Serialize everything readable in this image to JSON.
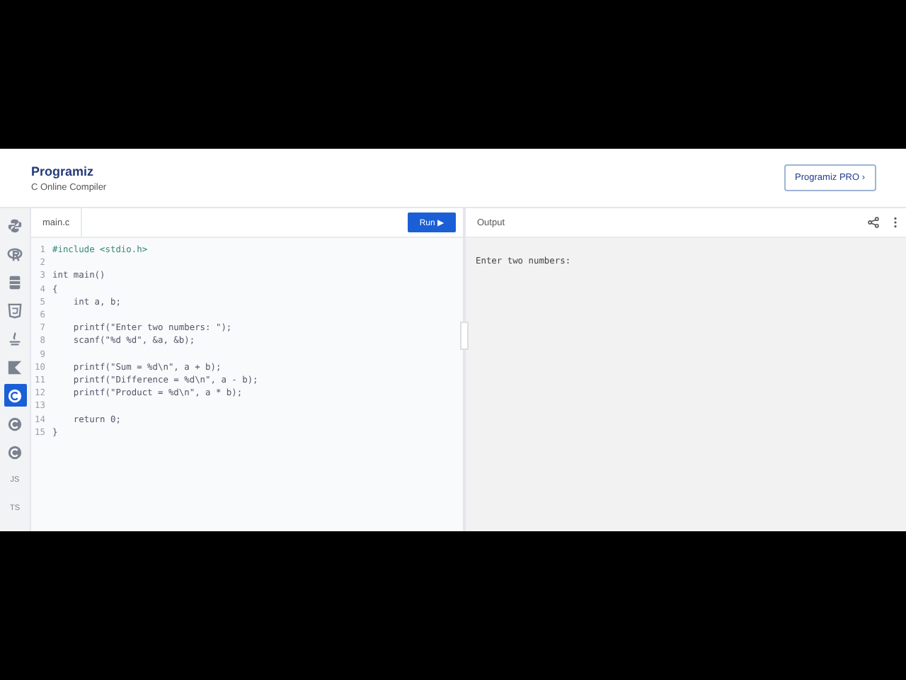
{
  "header": {
    "logo": "Programiz",
    "subtitle": "C Online Compiler",
    "pro_button": "Programiz PRO ›"
  },
  "sidebar": {
    "items": [
      {
        "kind": "python",
        "selected": false
      },
      {
        "kind": "r",
        "selected": false
      },
      {
        "kind": "sql",
        "selected": false
      },
      {
        "kind": "html",
        "selected": false
      },
      {
        "kind": "java",
        "selected": false
      },
      {
        "kind": "kotlin",
        "selected": false
      },
      {
        "kind": "c",
        "selected": true
      },
      {
        "kind": "cpp",
        "selected": false
      },
      {
        "kind": "csharp",
        "selected": false
      },
      {
        "kind": "text",
        "label": "JS",
        "selected": false
      },
      {
        "kind": "text",
        "label": "TS",
        "selected": false
      }
    ]
  },
  "editor": {
    "tab": "main.c",
    "run_button": "Run ▶",
    "lines": [
      {
        "number": "1",
        "code": "#include <stdio.h>",
        "kind": "directive"
      },
      {
        "number": "2"
      },
      {
        "number": "3",
        "code": "int main()",
        "kind": "code"
      },
      {
        "number": "4",
        "code": "{",
        "kind": "code"
      },
      {
        "number": "5",
        "code": "    int a, b;",
        "kind": "code"
      },
      {
        "number": "6"
      },
      {
        "number": "7",
        "code": "    printf(\"Enter two numbers: \");",
        "kind": "code"
      },
      {
        "number": "8",
        "code": "    scanf(\"%d %d\", &a, &b);",
        "kind": "code"
      },
      {
        "number": "9"
      },
      {
        "number": "10",
        "code": "    printf(\"Sum = %d\\n\", a + b);",
        "kind": "code"
      },
      {
        "number": "11",
        "code": "    printf(\"Difference = %d\\n\", a - b);",
        "kind": "code"
      },
      {
        "number": "12",
        "code": "    printf(\"Product = %d\\n\", a * b);",
        "kind": "code"
      },
      {
        "number": "13"
      },
      {
        "number": "14",
        "code": "    return 0;",
        "kind": "code"
      },
      {
        "number": "15",
        "code": "}",
        "kind": "code"
      }
    ]
  },
  "output": {
    "title": "Output",
    "text": "Enter two numbers:"
  }
}
